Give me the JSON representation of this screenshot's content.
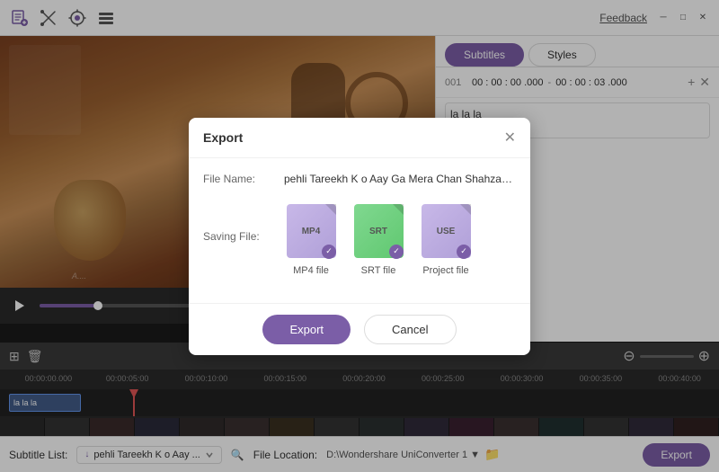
{
  "app": {
    "feedback": "Feedback",
    "window_controls": {
      "minimize": "─",
      "maximize": "□",
      "close": "✕"
    }
  },
  "toolbar": {
    "icons": [
      "new-project",
      "trim",
      "capture",
      "settings"
    ]
  },
  "tabs": {
    "subtitles": "Subtitles",
    "styles": "Styles",
    "active": "subtitles"
  },
  "subtitle_entry": {
    "number": "001",
    "time_start": "00 : 00 : 00 .000",
    "time_end": "00 : 00 : 03 .000",
    "text": "la la la"
  },
  "timeline": {
    "marks": [
      "00:00:00.000",
      "00:00:05:00",
      "00:00:10:00",
      "00:00:15:00",
      "00:00:20:00",
      "00:00:25:00",
      "00:00:30:00",
      "00:00:35:00",
      "00:00:40:00"
    ],
    "subtitle_block_text": "la la la"
  },
  "bottom_bar": {
    "subtitle_label": "Subtitle",
    "subtitle_list_label": "Subtitle List:",
    "dropdown_value": "↓  pehli Tareekh K o Aay ...",
    "file_location_label": "File Location:",
    "file_path": "D:\\Wondershare UniConverter 1 ▼",
    "export_label": "Export"
  },
  "dialog": {
    "title": "Export",
    "close_icon": "✕",
    "file_name_label": "File Name:",
    "file_name_value": "pehli Tareekh K o Aay Ga Mera Chan Shahzada Attaullah ▶",
    "saving_file_label": "Saving File:",
    "files": [
      {
        "id": "mp4",
        "type": "MP4",
        "label": "MP4 file",
        "checked": true,
        "bg_class": "mp4"
      },
      {
        "id": "srt",
        "type": "SRT",
        "label": "SRT file",
        "checked": true,
        "bg_class": "srt"
      },
      {
        "id": "use",
        "type": "USE",
        "label": "Project file",
        "checked": true,
        "bg_class": "use"
      }
    ],
    "export_btn": "Export",
    "cancel_btn": "Cancel"
  }
}
